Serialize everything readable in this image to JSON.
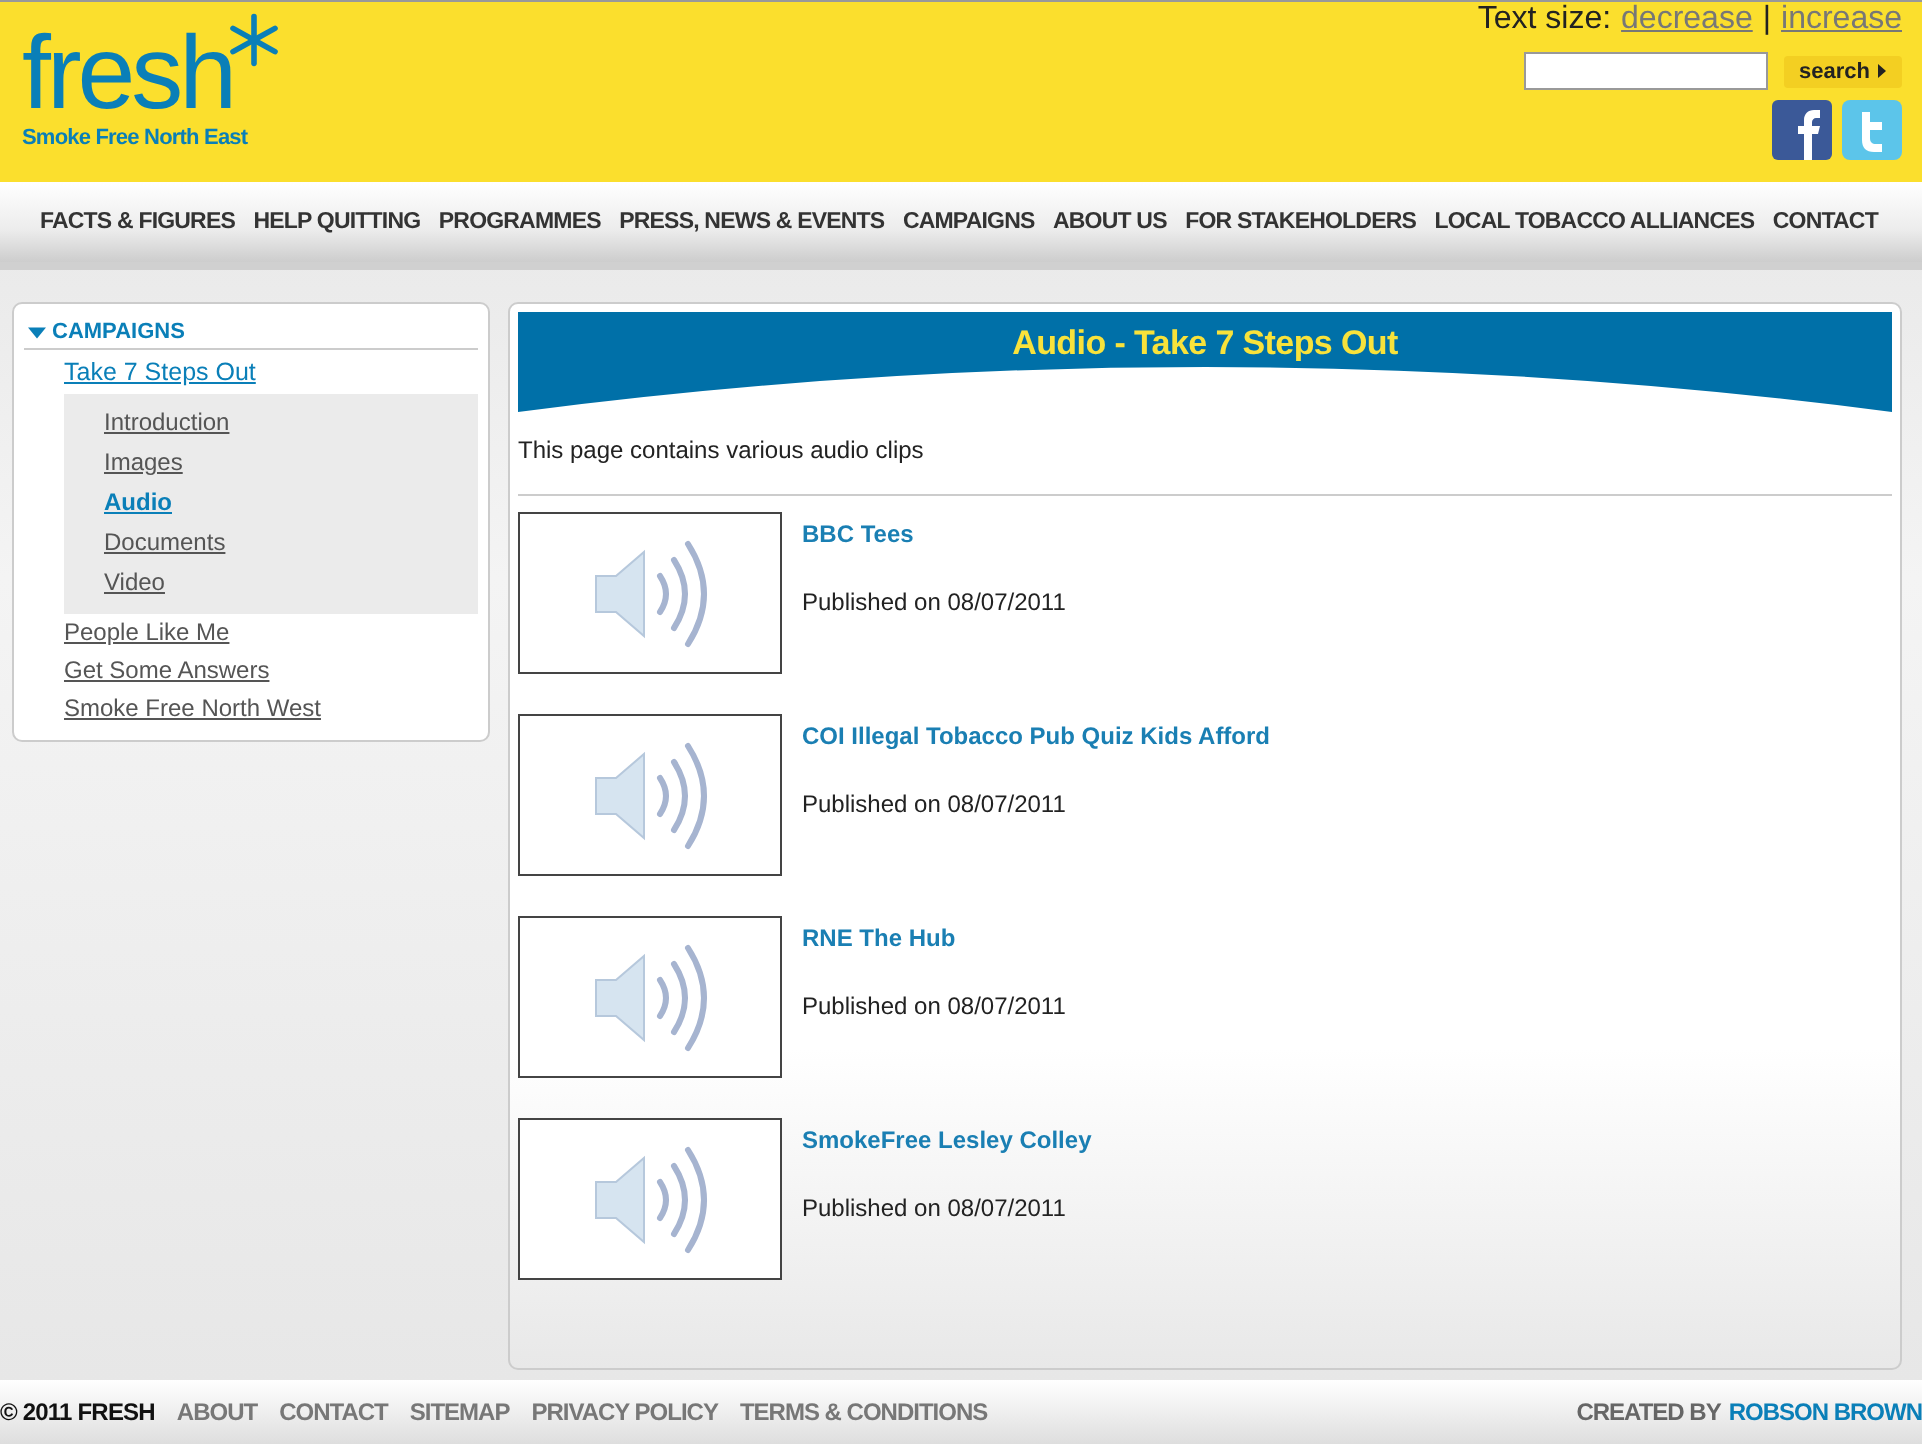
{
  "logo": {
    "wordmark": "fresh",
    "tagline": "Smoke Free North East"
  },
  "text_size": {
    "label": "Text size:",
    "decrease": "decrease",
    "separator": "|",
    "increase": "increase"
  },
  "search": {
    "button": "search"
  },
  "nav": [
    "FACTS & FIGURES",
    "HELP QUITTING",
    "PROGRAMMES",
    "PRESS, NEWS & EVENTS",
    "CAMPAIGNS",
    "ABOUT US",
    "FOR STAKEHOLDERS",
    "LOCAL TOBACCO ALLIANCES",
    "CONTACT"
  ],
  "sidebar": {
    "heading": "CAMPAIGNS",
    "expanded": true,
    "items": [
      {
        "label": "Take 7 Steps Out",
        "expanded": true,
        "children": [
          {
            "label": "Introduction",
            "selected": false
          },
          {
            "label": "Images",
            "selected": false
          },
          {
            "label": "Audio",
            "selected": true
          },
          {
            "label": "Documents",
            "selected": false
          },
          {
            "label": "Video",
            "selected": false
          }
        ]
      },
      {
        "label": "People Like Me",
        "expanded": false
      },
      {
        "label": "Get Some Answers",
        "expanded": false
      },
      {
        "label": "Smoke Free North West",
        "expanded": false
      }
    ]
  },
  "page": {
    "title": "Audio - Take 7 Steps Out",
    "intro": "This page contains various audio clips"
  },
  "clips": [
    {
      "title": "BBC Tees",
      "published": "Published on 08/07/2011"
    },
    {
      "title": "COI Illegal Tobacco Pub Quiz Kids Afford",
      "published": "Published on 08/07/2011"
    },
    {
      "title": "RNE The Hub",
      "published": "Published on 08/07/2011"
    },
    {
      "title": "SmokeFree Lesley Colley",
      "published": "Published on 08/07/2011"
    }
  ],
  "footer": {
    "copyright": "© 2011 FRESH",
    "links": [
      "ABOUT",
      "CONTACT",
      "SITEMAP",
      "PRIVACY POLICY",
      "TERMS & CONDITIONS"
    ],
    "credit_label": "CREATED BY",
    "credit_link": "ROBSON BROWN"
  }
}
